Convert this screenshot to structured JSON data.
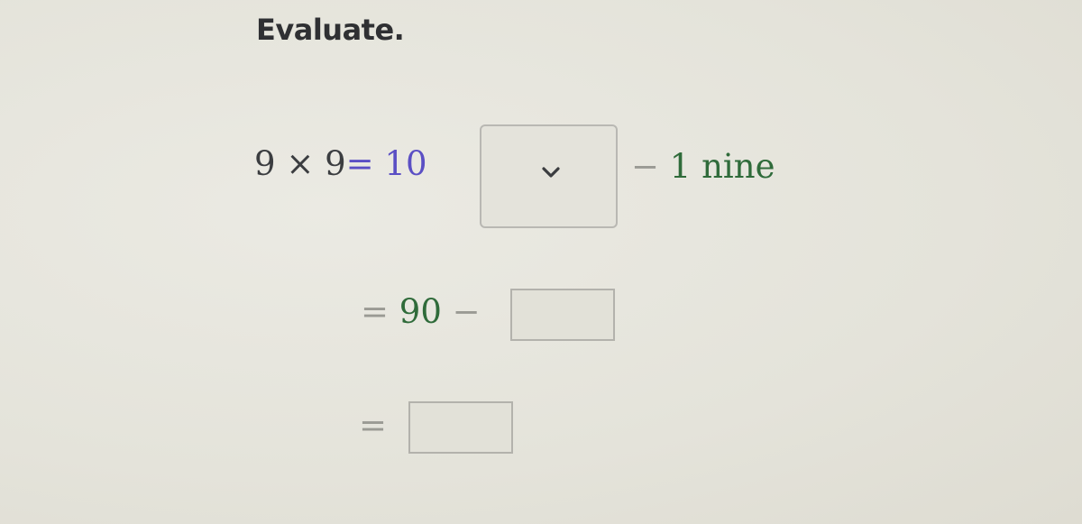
{
  "heading": "Evaluate.",
  "line1": {
    "expression_a": "9",
    "times": "×",
    "expression_b": "9",
    "equals": "=",
    "tens": "10",
    "dropdown_value": "",
    "minus": "−",
    "nine_count": "1",
    "nine_word": "nine"
  },
  "line2": {
    "equals": "=",
    "value": "90",
    "minus": "−",
    "answer": ""
  },
  "line3": {
    "equals": "=",
    "answer": ""
  },
  "icons": {
    "dropdown": "chevron-down-icon"
  },
  "colors": {
    "purple": "#5b4fc4",
    "green": "#2f6b3a",
    "text": "#3b3d40"
  }
}
